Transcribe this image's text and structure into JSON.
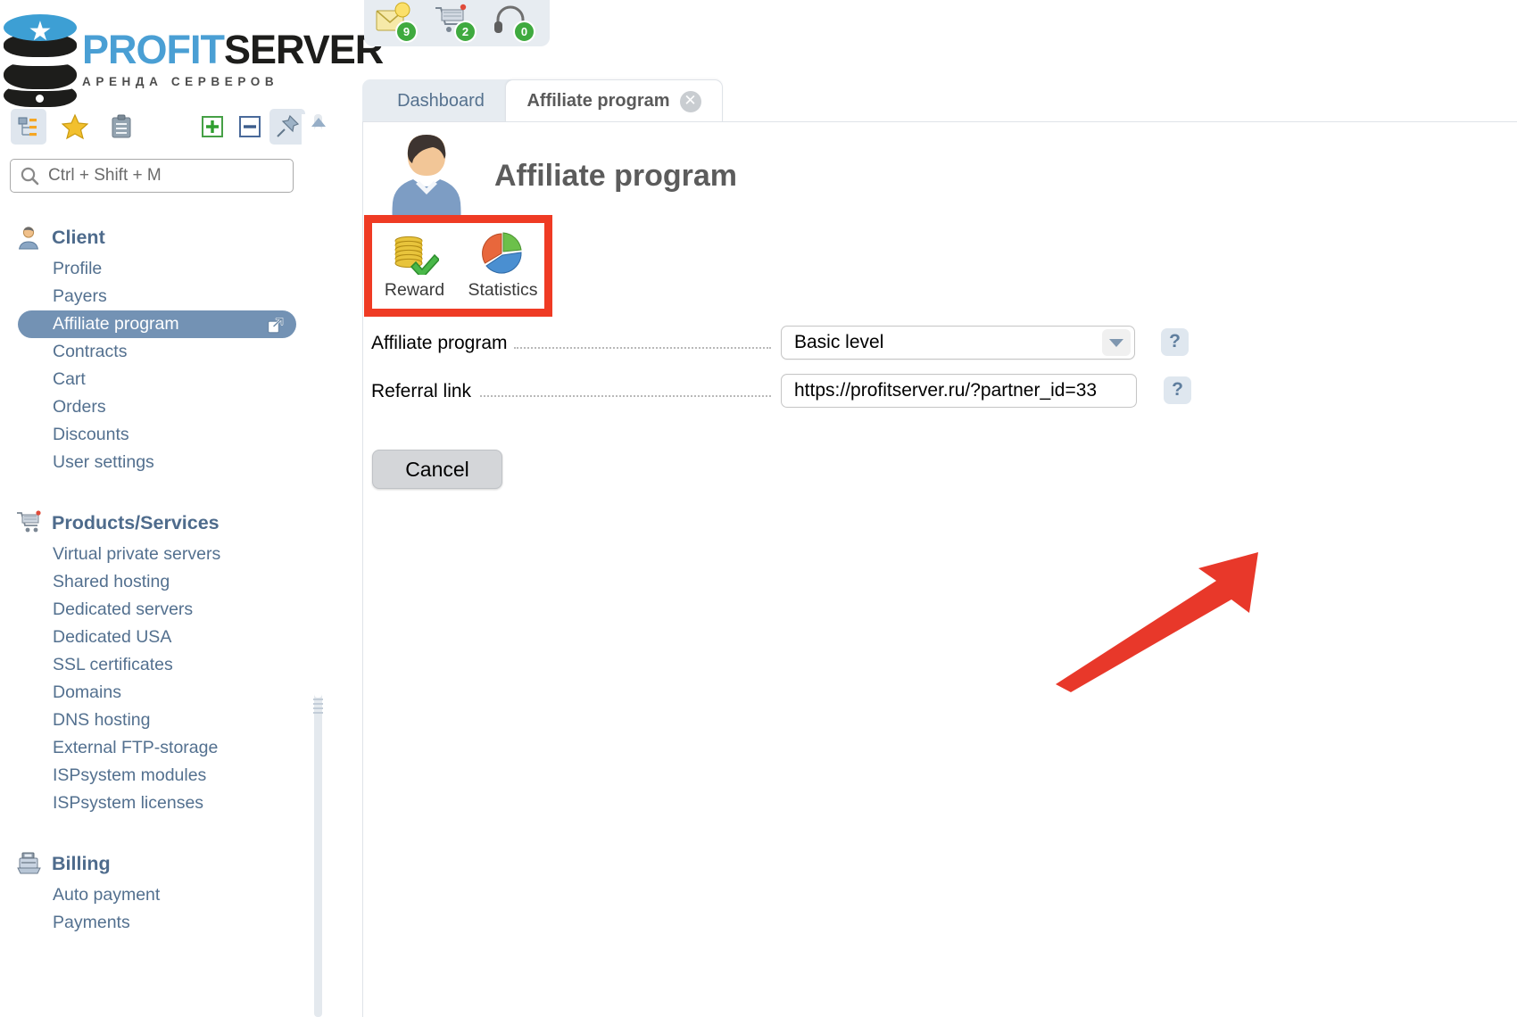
{
  "brand": {
    "name_part1": "PROFIT",
    "name_part2": "SERVER",
    "tagline": "АРЕНДА СЕРВЕРОВ"
  },
  "sidebar": {
    "toolbar": [
      {
        "name": "tree-view-icon",
        "label": "Tree view",
        "selected": true
      },
      {
        "name": "favorites-star-icon",
        "label": "Favorites",
        "selected": false
      },
      {
        "name": "clipboard-icon",
        "label": "Clipboard",
        "selected": false
      },
      {
        "name": "expand-all-icon",
        "label": "Expand all",
        "selected": false
      },
      {
        "name": "collapse-all-icon",
        "label": "Collapse all",
        "selected": false
      },
      {
        "name": "pin-icon",
        "label": "Pin menu",
        "selected": true
      }
    ],
    "search": {
      "placeholder": "Ctrl + Shift + M"
    },
    "groups": [
      {
        "title": "Client",
        "icon": "user-icon",
        "items": [
          {
            "label": "Profile",
            "active": false
          },
          {
            "label": "Payers",
            "active": false
          },
          {
            "label": "Affiliate program",
            "active": true
          },
          {
            "label": "Contracts",
            "active": false
          },
          {
            "label": "Cart",
            "active": false
          },
          {
            "label": "Orders",
            "active": false
          },
          {
            "label": "Discounts",
            "active": false
          },
          {
            "label": "User settings",
            "active": false
          }
        ]
      },
      {
        "title": "Products/Services",
        "icon": "cart-icon",
        "items": [
          {
            "label": "Virtual private servers",
            "active": false
          },
          {
            "label": "Shared hosting",
            "active": false
          },
          {
            "label": "Dedicated servers",
            "active": false
          },
          {
            "label": "Dedicated USA",
            "active": false
          },
          {
            "label": "SSL certificates",
            "active": false
          },
          {
            "label": "Domains",
            "active": false
          },
          {
            "label": "DNS hosting",
            "active": false
          },
          {
            "label": "External FTP-storage",
            "active": false
          },
          {
            "label": "ISPsystem modules",
            "active": false
          },
          {
            "label": "ISPsystem licenses",
            "active": false
          }
        ]
      },
      {
        "title": "Billing",
        "icon": "cash-register-icon",
        "items": [
          {
            "label": "Auto payment",
            "active": false
          },
          {
            "label": "Payments",
            "active": false
          }
        ]
      }
    ]
  },
  "topbar": {
    "icons": [
      {
        "name": "messages-icon",
        "badge": "9"
      },
      {
        "name": "cart-icon",
        "badge": "2"
      },
      {
        "name": "support-headset-icon",
        "badge": "0"
      }
    ]
  },
  "tabs": [
    {
      "label": "Dashboard",
      "active": false
    },
    {
      "label": "Affiliate program",
      "active": true,
      "closable": true
    }
  ],
  "page": {
    "title": "Affiliate program",
    "actions": [
      {
        "label": "Reward",
        "icon": "coins-check-icon"
      },
      {
        "label": "Statistics",
        "icon": "pie-chart-icon"
      }
    ],
    "form": {
      "rows": [
        {
          "label": "Affiliate program",
          "control": "select",
          "value": "Basic level",
          "help": "?"
        },
        {
          "label": "Referral link",
          "control": "input",
          "value": "https://profitserver.ru/?partner_id=33",
          "help": "?"
        }
      ],
      "cancel_label": "Cancel"
    }
  },
  "annotations": {
    "highlight_color": "#ef3b24",
    "arrow_color": "#e8382a"
  }
}
